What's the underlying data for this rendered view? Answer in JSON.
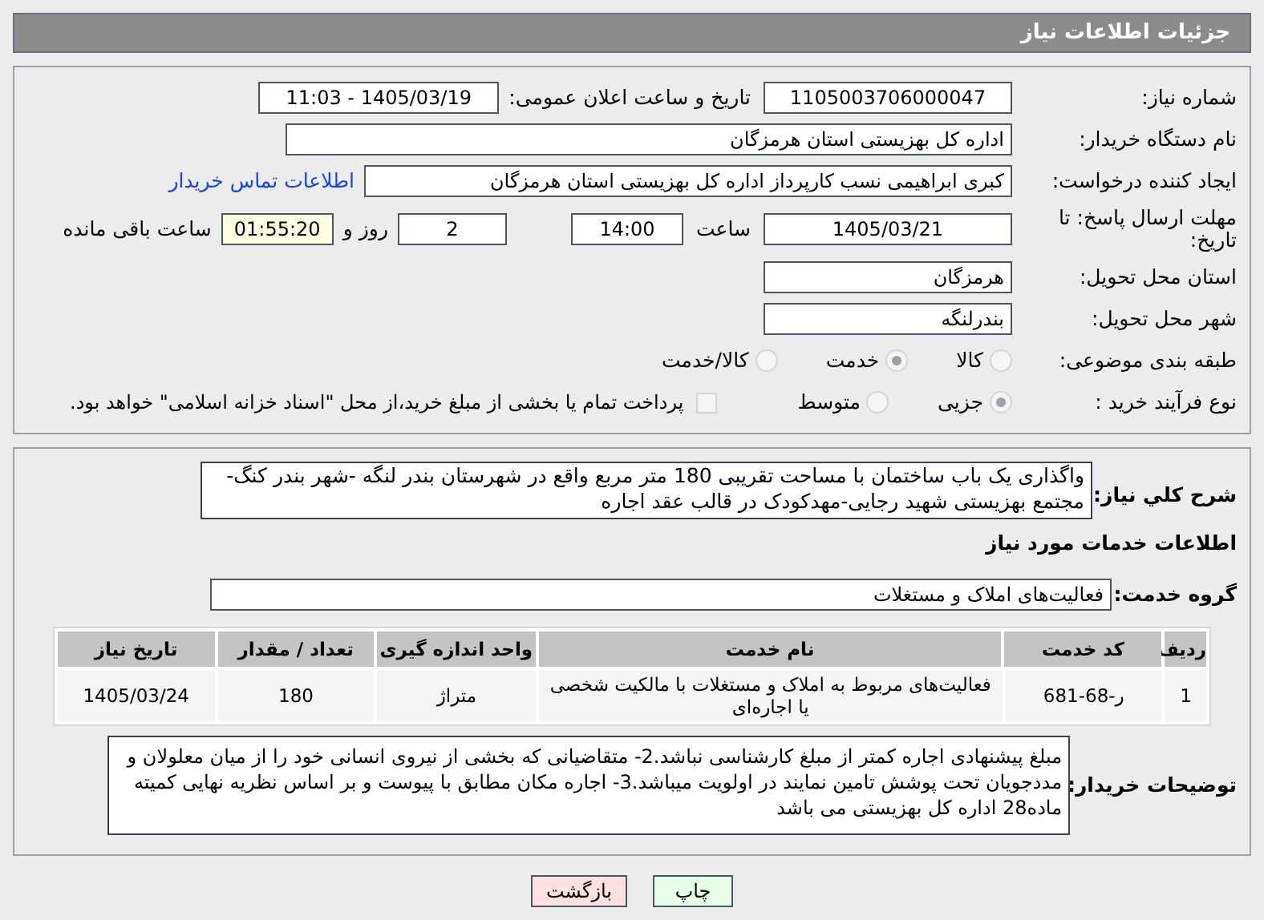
{
  "header": {
    "title": "جزئیات اطلاعات نیاز"
  },
  "form": {
    "need_number": {
      "label": "شماره نیاز:",
      "value": "1105003706000047"
    },
    "announce": {
      "label": "تاریخ و ساعت اعلان عمومی:",
      "value": "1405/03/19 - 11:03"
    },
    "buyer_org": {
      "label": "نام دستگاه خریدار:",
      "value": "اداره کل بهزیستی استان هرمزگان"
    },
    "requester": {
      "label": "ایجاد کننده درخواست:",
      "value": "کبری  ابراهیمی نسب کارپرداز اداره کل بهزیستی استان هرمزگان",
      "link": "اطلاعات تماس خریدار"
    },
    "deadline": {
      "label": "مهلت ارسال پاسخ: تا تاریخ:",
      "date": "1405/03/21",
      "time_label": "ساعت",
      "time": "14:00",
      "days": "2",
      "days_label": "روز و",
      "remaining": "01:55:20",
      "remaining_label": "ساعت باقی مانده"
    },
    "province": {
      "label": "استان محل تحویل:",
      "value": "هرمزگان"
    },
    "city": {
      "label": "شهر محل تحویل:",
      "value": "بندرلنگه"
    },
    "category": {
      "label": "طبقه بندی موضوعی:",
      "options": [
        {
          "label": "کالا",
          "selected": false
        },
        {
          "label": "خدمت",
          "selected": true
        },
        {
          "label": "کالا/خدمت",
          "selected": false
        }
      ]
    },
    "purchase_type": {
      "label": "نوع فرآیند خرید :",
      "options": [
        {
          "label": "جزیی",
          "selected": true
        },
        {
          "label": "متوسط",
          "selected": false
        }
      ],
      "payment": {
        "checked": false,
        "text": "پرداخت تمام یا بخشی از مبلغ خرید،از محل \"اسناد خزانه اسلامی\" خواهد بود."
      }
    }
  },
  "details": {
    "description": {
      "label": "شرح کلي نياز:",
      "value": "واگذاری یک باب ساختمان با مساحت تقریبی 180 متر مربع واقع در شهرستان بندر لنگه -شهر بندر کنگ-مجتمع بهزیستی شهید رجایی-مهدکودک در قالب عقد اجاره"
    },
    "services_heading": "اطلاعات خدمات مورد نیاز",
    "service_group": {
      "label": "گروه خدمت:",
      "value": "فعالیت‌های  املاک و مستغلات"
    },
    "table": {
      "columns": [
        "ردیف",
        "کد خدمت",
        "نام خدمت",
        "واحد اندازه گیری",
        "تعداد / مقدار",
        "تاریخ نیاز"
      ],
      "rows": [
        [
          "1",
          "ر-68-681",
          "فعالیت‌های مربوط به املاک و مستغلات با مالکیت شخصی یا اجاره‌ای",
          "متراژ",
          "180",
          "1405/03/24"
        ]
      ]
    },
    "buyer_notes": {
      "label": "توضیحات خریدار:",
      "value": "مبلغ پیشنهادی  اجاره کمتر از مبلغ کارشناسی نباشد.2- متقاضیانی که بخشی از نیروی انسانی خود را از میان معلولان و مددجویان تحت پوشش تامین نمایند در اولویت میباشد.3-  اجاره مکان  مطابق با پیوست و بر اساس نظریه نهایی کمیته ماده28 اداره کل بهزیستی می باشد"
    }
  },
  "buttons": [
    {
      "label": "چاپ",
      "kind": "print"
    },
    {
      "label": "بازگشت",
      "kind": "back"
    }
  ]
}
